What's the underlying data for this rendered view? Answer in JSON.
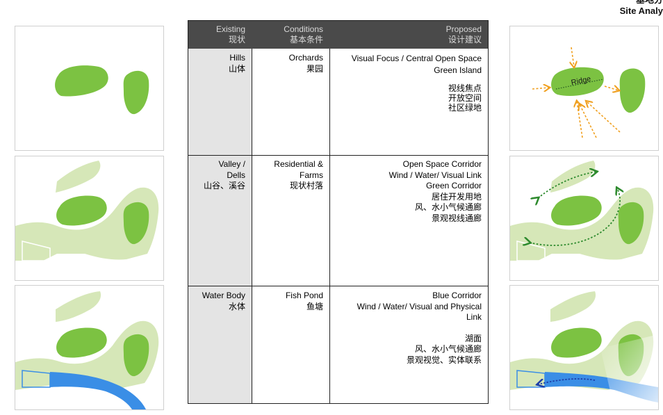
{
  "header": {
    "title_line1": "基地分",
    "title_line2": "Site Analy"
  },
  "table": {
    "columns": [
      {
        "en": "Existing",
        "cn": "现状"
      },
      {
        "en": "Conditions",
        "cn": "基本条件"
      },
      {
        "en": "Proposed",
        "cn": "设计建议"
      }
    ],
    "rows": [
      {
        "existing": {
          "en": [
            "Hills"
          ],
          "cn": "山体"
        },
        "conditions": {
          "en": [
            "Orchards"
          ],
          "cn": "果园"
        },
        "proposed": {
          "en": [
            "Visual Focus /  Central Open Space",
            "Green Island"
          ],
          "cn": [
            "视线焦点",
            "开放空间",
            "社区绿地"
          ]
        }
      },
      {
        "existing": {
          "en": [
            "Valley /",
            "Dells"
          ],
          "cn": "山谷、溪谷"
        },
        "conditions": {
          "en": [
            "Residential &",
            "Farms"
          ],
          "cn": "现状村落"
        },
        "proposed": {
          "en": [
            "Open Space Corridor",
            "Wind / Water/  Visual Link",
            "Green Corridor"
          ],
          "cn": [
            "居住开发用地",
            "风、水小气候通廊",
            "景观视线通廊"
          ]
        }
      },
      {
        "existing": {
          "en": [
            "Water Body"
          ],
          "cn": "水体"
        },
        "conditions": {
          "en": [
            "Fish Pond"
          ],
          "cn": "鱼塘"
        },
        "proposed": {
          "en": [
            "Blue Corridor",
            "Wind / Water/ Visual and Physical",
            "Link"
          ],
          "cn": [
            "湖面",
            "风、水小气候通廊",
            "景观视觉、实体联系"
          ]
        }
      }
    ]
  },
  "diagram": {
    "ridge_label": "Ridge"
  },
  "colors": {
    "hill_green": "#7cc242",
    "valley_green": "#d6e7b8",
    "water_blue": "#3a8ee6",
    "arrow_orange": "#f0a020",
    "arrow_green": "#2d8a2d",
    "arrow_blue": "#1e3fa8",
    "header_bg": "#4a4a4a",
    "existing_col_bg": "#e4e4e4"
  }
}
